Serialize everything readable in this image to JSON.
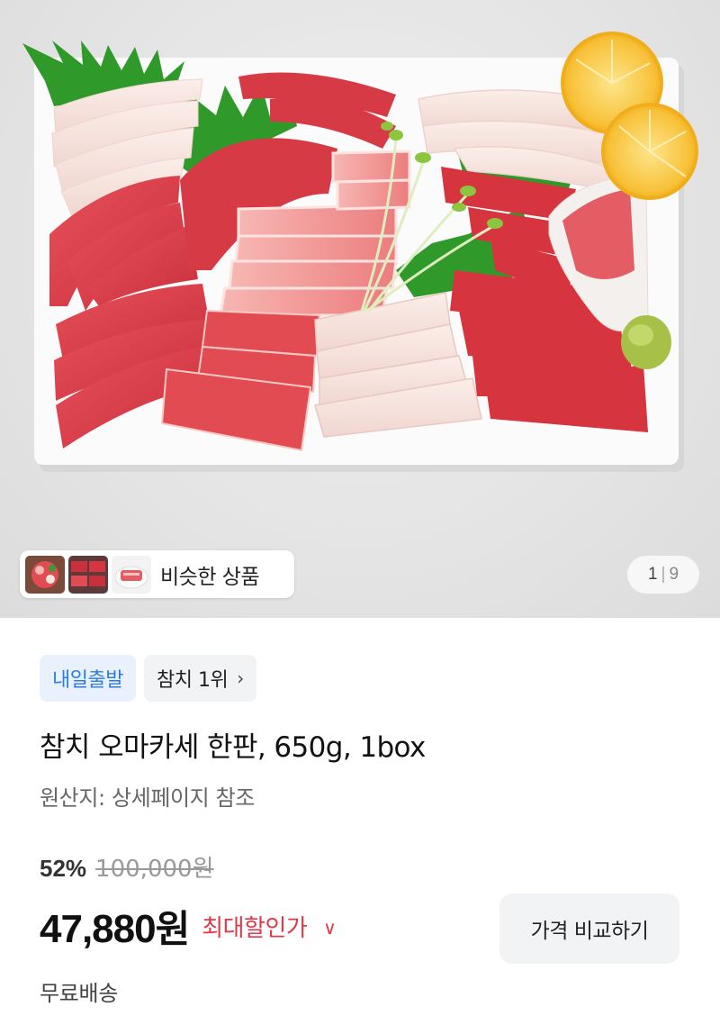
{
  "gallery": {
    "similar_products_label": "비슷한 상품",
    "page_current": "1",
    "page_separator": "|",
    "page_total": "9"
  },
  "badges": {
    "delivery": "내일출발",
    "ranking": "참치 1위"
  },
  "product": {
    "title": "참치 오마카세 한판, 650g, 1box",
    "origin": "원산지: 상세페이지 참조"
  },
  "price": {
    "discount_rate": "52%",
    "original_price": "100,000원",
    "sale_amount": "47,880",
    "currency": "원",
    "max_discount_label": "최대할인가",
    "compare_button": "가격 비교하기"
  },
  "shipping": {
    "label": "무료배송"
  },
  "colors": {
    "badge_blue_text": "#2c7be0",
    "badge_blue_bg": "#e8f1fc",
    "max_discount_red": "#e0394a"
  },
  "icons": {
    "ranking_chevron": "chevron-right-icon",
    "max_discount_chevron": "chevron-down-icon"
  }
}
